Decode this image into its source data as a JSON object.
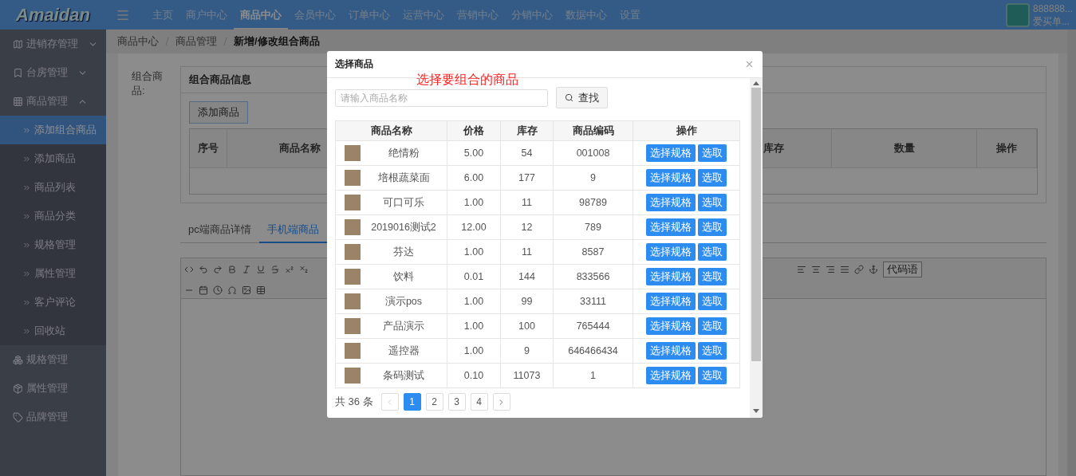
{
  "header": {
    "logo": "Amaidan",
    "nav": [
      {
        "label": "主页",
        "selected": false
      },
      {
        "label": "商户中心",
        "selected": false
      },
      {
        "label": "商品中心",
        "selected": true
      },
      {
        "label": "会员中心",
        "selected": false
      },
      {
        "label": "订单中心",
        "selected": false
      },
      {
        "label": "运营中心",
        "selected": false
      },
      {
        "label": "营销中心",
        "selected": false
      },
      {
        "label": "分销中心",
        "selected": false
      },
      {
        "label": "数据中心",
        "selected": false
      },
      {
        "label": "设置",
        "selected": false
      }
    ],
    "user": {
      "name": "888888...",
      "shop": "爱买单..."
    }
  },
  "sidebar": {
    "items": [
      {
        "label": "进销存管理",
        "expanded": false
      },
      {
        "label": "台房管理",
        "expanded": false
      },
      {
        "label": "商品管理",
        "expanded": true,
        "children": [
          {
            "label": "添加组合商品",
            "selected": true
          },
          {
            "label": "添加商品",
            "selected": false
          },
          {
            "label": "商品列表",
            "selected": false
          },
          {
            "label": "商品分类",
            "selected": false
          },
          {
            "label": "规格管理",
            "selected": false
          },
          {
            "label": "属性管理",
            "selected": false
          },
          {
            "label": "客户评论",
            "selected": false
          },
          {
            "label": "回收站",
            "selected": false
          }
        ]
      },
      {
        "label": "规格管理"
      },
      {
        "label": "属性管理"
      },
      {
        "label": "品牌管理"
      }
    ]
  },
  "breadcrumb": [
    "商品中心",
    "商品管理",
    "新增/修改组合商品"
  ],
  "form": {
    "label": "组合商品:",
    "panel": {
      "title": "组合商品信息",
      "add_button": "添加商品",
      "columns": [
        "序号",
        "商品名称",
        "库存",
        "数量",
        "操作"
      ]
    }
  },
  "tabs": [
    {
      "label": "pc端商品详情",
      "selected": false
    },
    {
      "label": "手机端商品",
      "selected": true
    }
  ],
  "editor": {
    "font_select": "代码语"
  },
  "modal": {
    "title": "选择商品",
    "note": "选择要组合的商品",
    "search": {
      "placeholder": "请输入商品名称",
      "button": "查找"
    },
    "columns": [
      "商品名称",
      "价格",
      "库存",
      "商品编码",
      "操作"
    ],
    "rows": [
      {
        "name": "绝情粉",
        "price": "5.00",
        "stock": "54",
        "code": "001008",
        "actions": [
          "选择规格",
          "选取"
        ]
      },
      {
        "name": "培根蔬菜面",
        "price": "6.00",
        "stock": "177",
        "code": "9",
        "actions": [
          "选择规格",
          "选取"
        ]
      },
      {
        "name": "可口可乐",
        "price": "1.00",
        "stock": "11",
        "code": "98789",
        "actions": [
          "选择规格",
          "选取"
        ]
      },
      {
        "name": "2019016测试2",
        "price": "12.00",
        "stock": "12",
        "code": "789",
        "actions": [
          "选择规格",
          "选取"
        ]
      },
      {
        "name": "芬达",
        "price": "1.00",
        "stock": "11",
        "code": "8587",
        "actions": [
          "选择规格",
          "选取"
        ]
      },
      {
        "name": "饮料",
        "price": "0.01",
        "stock": "144",
        "code": "833566",
        "actions": [
          "选择规格",
          "选取"
        ]
      },
      {
        "name": "演示pos",
        "price": "1.00",
        "stock": "99",
        "code": "33111",
        "actions": [
          "选择规格",
          "选取"
        ]
      },
      {
        "name": "产品演示",
        "price": "1.00",
        "stock": "100",
        "code": "765444",
        "actions": [
          "选择规格",
          "选取"
        ]
      },
      {
        "name": "遥控器",
        "price": "1.00",
        "stock": "9",
        "code": "646466434",
        "actions": [
          "选择规格",
          "选取"
        ]
      },
      {
        "name": "条码测试",
        "price": "0.10",
        "stock": "11073",
        "code": "1",
        "actions": [
          "选择规格",
          "选取"
        ]
      }
    ],
    "pagination": {
      "total": "共 36 条",
      "pages": [
        {
          "label": "1",
          "selected": true
        },
        {
          "label": "2",
          "selected": false
        },
        {
          "label": "3",
          "selected": false
        },
        {
          "label": "4",
          "selected": false
        }
      ]
    }
  }
}
